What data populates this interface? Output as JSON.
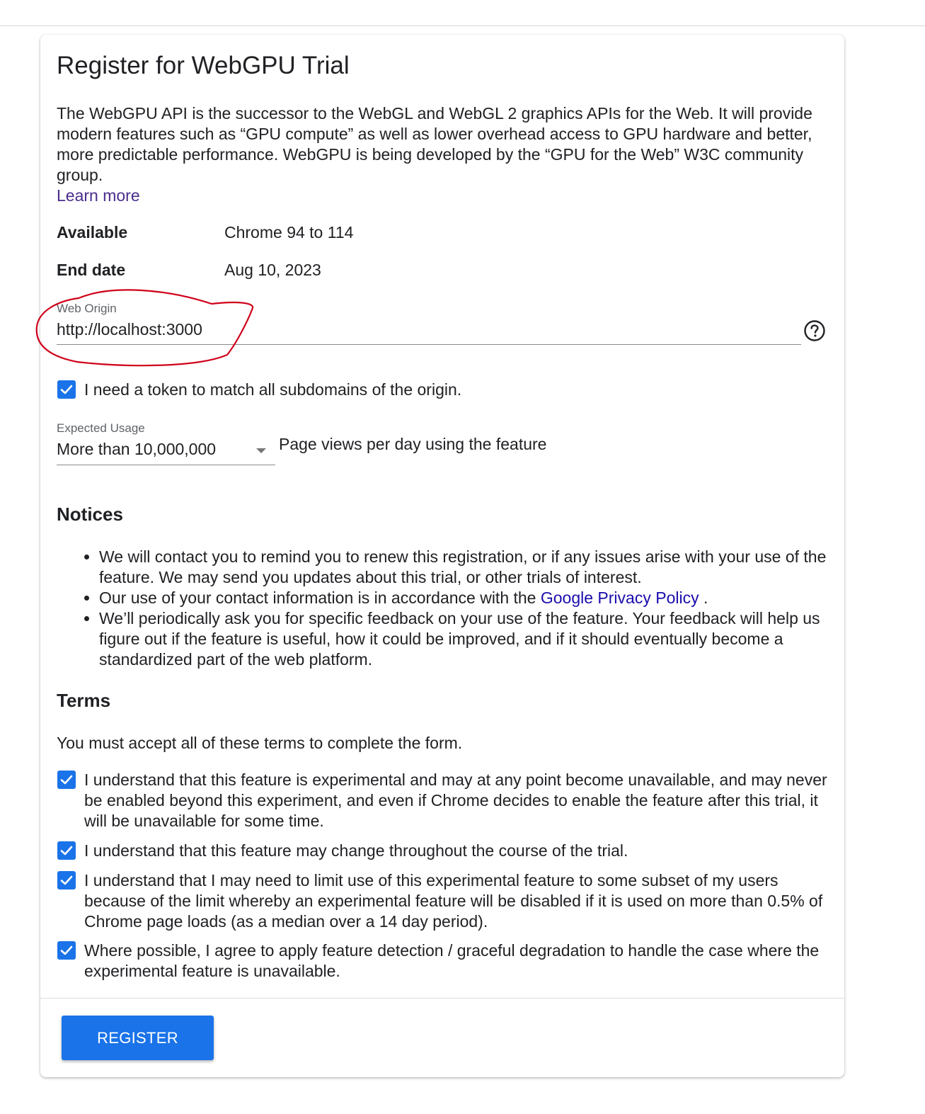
{
  "form": {
    "title": "Register for WebGPU Trial",
    "description": "The WebGPU API is the successor to the WebGL and WebGL 2 graphics APIs for the Web. It will provide modern features such as “GPU compute” as well as lower overhead access to GPU hardware and better, more predictable performance. WebGPU is being developed by the “GPU for the Web” W3C community group.",
    "learn_more": "Learn more",
    "available_label": "Available",
    "available_value": "Chrome 94 to 114",
    "end_date_label": "End date",
    "end_date_value": "Aug 10, 2023",
    "web_origin_label": "Web Origin",
    "web_origin_value": "http://localhost:3000",
    "help_icon": "help-circle-icon",
    "subdomain_checkbox_label": "I need a token to match all subdomains of the origin.",
    "subdomain_checked": true,
    "expected_usage_label": "Expected Usage",
    "expected_usage_value": "More than 10,000,000",
    "expected_usage_suffix": "Page views per day using the feature",
    "annotation_color": "#d0021b"
  },
  "notices": {
    "heading": "Notices",
    "item1": "We will contact you to remind you to renew this registration, or if any issues arise with your use of the feature. We may send you updates about this trial, or other trials of interest.",
    "item2_prefix": "Our use of your contact information is in accordance with the",
    "item2_link": "Google Privacy Policy",
    "item2_suffix": ".",
    "item3": "We’ll periodically ask you for specific feedback on your use of the feature. Your feedback will help us figure out if the feature is useful, how it could be improved, and if it should eventually become a standardized part of the web platform."
  },
  "terms": {
    "heading": "Terms",
    "intro": "You must accept all of these terms to complete the form.",
    "items": [
      {
        "label": "I understand that this feature is experimental and may at any point become unavailable, and may never be enabled beyond this experiment, and even if Chrome decides to enable the feature after this trial, it will be unavailable for some time.",
        "checked": true
      },
      {
        "label": "I understand that this feature may change throughout the course of the trial.",
        "checked": true
      },
      {
        "label": "I understand that I may need to limit use of this experimental feature to some subset of my users because of the limit whereby an experimental feature will be disabled if it is used on more than 0.5% of Chrome page loads (as a median over a 14 day period).",
        "checked": true
      },
      {
        "label": "Where possible, I agree to apply feature detection / graceful degradation to handle the case where the experimental feature is unavailable.",
        "checked": true
      }
    ]
  },
  "actions": {
    "register_label": "REGISTER"
  },
  "colors": {
    "accent": "#1a73e8",
    "link": "#1a0dab",
    "visited_link": "#4a2d8c"
  }
}
